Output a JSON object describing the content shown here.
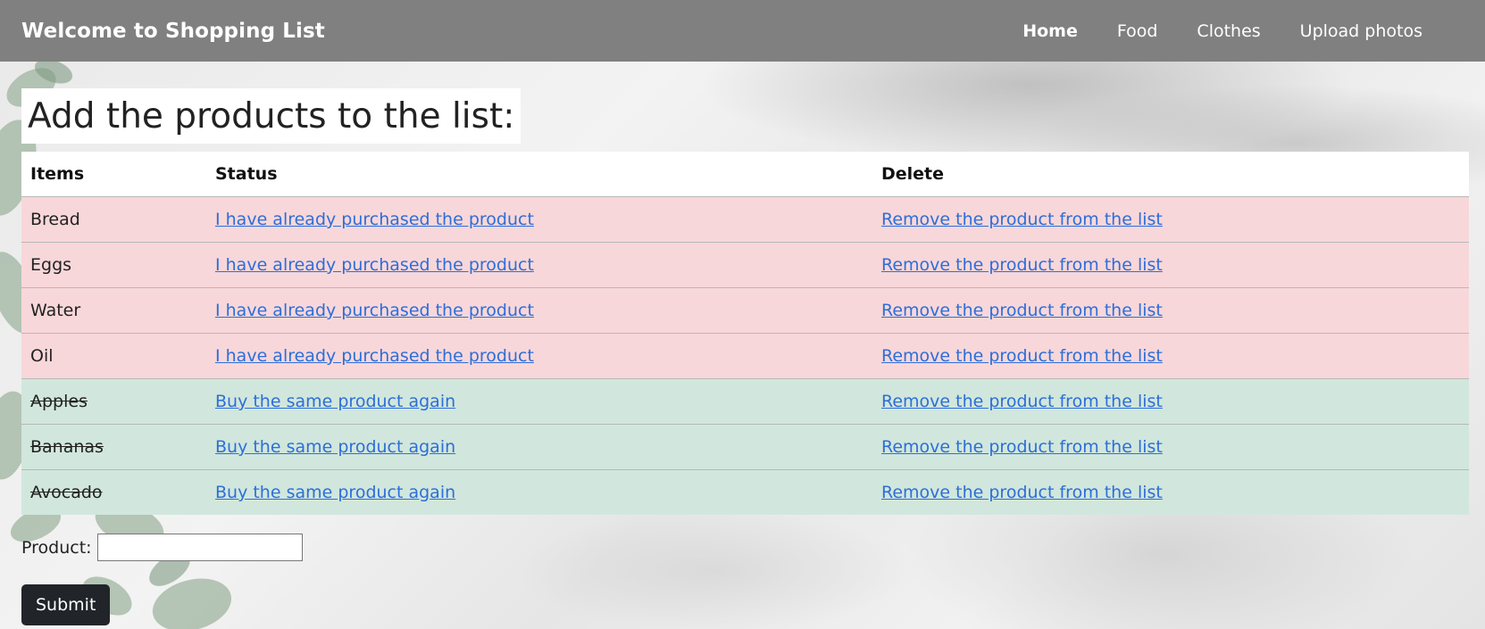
{
  "navbar": {
    "brand": "Welcome to Shopping List",
    "links": [
      {
        "label": "Home",
        "active": true
      },
      {
        "label": "Food",
        "active": false
      },
      {
        "label": "Clothes",
        "active": false
      },
      {
        "label": "Upload photos",
        "active": false
      }
    ]
  },
  "heading": "Add the products to the list:",
  "table": {
    "headers": [
      "Items",
      "Status",
      "Delete"
    ],
    "rows": [
      {
        "item": "Bread",
        "status_link": "I have already purchased the product",
        "delete_link": "Remove the product from the list",
        "purchased": false
      },
      {
        "item": "Eggs",
        "status_link": "I have already purchased the product",
        "delete_link": "Remove the product from the list",
        "purchased": false
      },
      {
        "item": "Water",
        "status_link": "I have already purchased the product",
        "delete_link": "Remove the product from the list",
        "purchased": false
      },
      {
        "item": "Oil",
        "status_link": "I have already purchased the product",
        "delete_link": "Remove the product from the list",
        "purchased": false
      },
      {
        "item": "Apples",
        "status_link": "Buy the same product again",
        "delete_link": "Remove the product from the list",
        "purchased": true
      },
      {
        "item": "Bananas",
        "status_link": "Buy the same product again",
        "delete_link": "Remove the product from the list",
        "purchased": true
      },
      {
        "item": "Avocado",
        "status_link": "Buy the same product again",
        "delete_link": "Remove the product from the list",
        "purchased": true
      }
    ]
  },
  "form": {
    "product_label": "Product:",
    "product_value": "",
    "submit_label": "Submit"
  },
  "colors": {
    "navbar": "#808080",
    "pending_row": "#f8d7da",
    "purchased_row": "#d1e7dd",
    "link": "#2d6ed8",
    "submit_button": "#212529"
  }
}
